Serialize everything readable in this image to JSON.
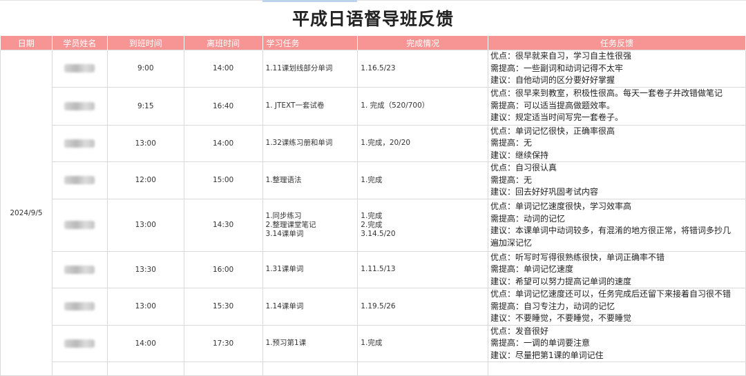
{
  "title": "平成日语督导班反馈",
  "headers": {
    "date": "日期",
    "name": "学员姓名",
    "arrive": "到班时间",
    "leave": "离班时间",
    "task": "学习任务",
    "completion": "完成情况",
    "feedback": "任务反馈"
  },
  "date": "2024/9/5",
  "rows": [
    {
      "arrive": "9:00",
      "leave": "14:00",
      "task": [
        "1.11课划线部分单词"
      ],
      "completion": [
        "1.16.5/23"
      ],
      "feedback": [
        "优点：很早就来自习，学习自主性很强",
        "需提高：一些副词和动词记得不太牢",
        "建议：自他动词的区分要好好掌握"
      ]
    },
    {
      "arrive": "9:15",
      "leave": "16:40",
      "task": [
        "1. JTEXT一套试卷"
      ],
      "completion": [
        "1. 完成（520/700）"
      ],
      "feedback": [
        "优点：很早来到教室，积极性很高。每天一套卷子并改错做笔记",
        "需提高：可以适当提高做题效率。",
        "建议：规定适当时间写完一套卷子。"
      ]
    },
    {
      "arrive": "13:00",
      "leave": "14:00",
      "task": [
        "1.32课练习册和单词"
      ],
      "completion": [
        "1.完成，20/20"
      ],
      "feedback": [
        "优点：单词记忆很快，正确率很高",
        "需提高：无",
        "建议：继续保持"
      ]
    },
    {
      "arrive": "12:00",
      "leave": "15:00",
      "task": [
        "1.整理语法"
      ],
      "completion": [
        "1.完成"
      ],
      "feedback": [
        "优点：自习很认真",
        "需提高：无",
        "建议：回去好好巩固考试内容"
      ]
    },
    {
      "arrive": "13:00",
      "leave": "14:30",
      "task": [
        "1.同步练习",
        "2.整理课堂笔记",
        "3.14课单词"
      ],
      "completion": [
        "1.完成",
        "2.完成",
        "3.14.5/20"
      ],
      "feedback": [
        "优点：单词记忆速度很快，学习效率高",
        "需提高：动词的记忆",
        "建议：本课单词中动词较多，有混淆的地方很正常，将错词多抄几",
        "遍加深记忆"
      ]
    },
    {
      "arrive": "13:30",
      "leave": "16:00",
      "task": [
        "1.31课单词"
      ],
      "completion": [
        "1.11.5/13"
      ],
      "feedback": [
        "优点：听写时写得很熟练很快，单词正确率不错",
        "需提高：单词记忆速度",
        "建议：希望可以努力提高记单词的速度"
      ]
    },
    {
      "arrive": "13:00",
      "leave": "15:30",
      "task": [
        "1.14课单词"
      ],
      "completion": [
        "1.19.5/26"
      ],
      "feedback": [
        "优点：单词记忆速度还可以，任务完成后还留下来接着自习很不错",
        "需提高：自习专注力，动词的记忆",
        "建议：不要睡觉，不要睡觉，不要睡觉"
      ]
    },
    {
      "arrive": "14:00",
      "leave": "17:30",
      "task": [
        "1.预习第1课"
      ],
      "completion": [
        "1.完成"
      ],
      "feedback": [
        "优点：发音很好",
        "需提高：一调的单词要注意",
        "建议：尽量把第1课的单词记住"
      ]
    }
  ]
}
